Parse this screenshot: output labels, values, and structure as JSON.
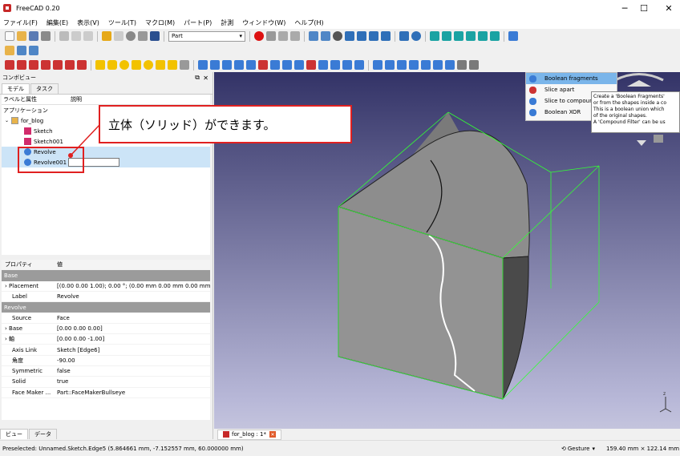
{
  "window": {
    "title": "FreeCAD 0.20"
  },
  "menubar": [
    "ファイル(F)",
    "編集(E)",
    "表示(V)",
    "ツール(T)",
    "マクロ(M)",
    "パート(P)",
    "計測",
    "ウィンドウ(W)",
    "ヘルプ(H)"
  ],
  "toolbar": {
    "workbench": "Part"
  },
  "combo": {
    "title": "コンボビュー",
    "tabs": [
      "モデル",
      "タスク"
    ],
    "tree_headers": [
      "ラベルと属性",
      "説明"
    ],
    "tree": {
      "root": "アプリケーション",
      "doc": "for_blog",
      "items": [
        "Sketch",
        "Sketch001",
        "Revolve",
        "Revolve001"
      ]
    },
    "props_headers": [
      "プロパティ",
      "値"
    ],
    "groups": [
      {
        "name": "Base",
        "rows": [
          {
            "k": "Placement",
            "v": "[(0.00 0.00 1.00); 0.00 °; (0.00 mm  0.00 mm  0.00 mm)]",
            "exp": true
          },
          {
            "k": "Label",
            "v": "Revolve",
            "exp": false
          }
        ]
      },
      {
        "name": "Revolve",
        "rows": [
          {
            "k": "Source",
            "v": "Face",
            "exp": false
          },
          {
            "k": "Base",
            "v": "[0.00 0.00 0.00]",
            "exp": true
          },
          {
            "k": "軸",
            "v": "[0.00 0.00 -1.00]",
            "exp": true
          },
          {
            "k": "Axis Link",
            "v": "Sketch [Edge6]",
            "exp": false
          },
          {
            "k": "角度",
            "v": "-90.00",
            "exp": false
          },
          {
            "k": "Symmetric",
            "v": "false",
            "exp": false
          },
          {
            "k": "Solid",
            "v": "true",
            "exp": false
          },
          {
            "k": "Face Maker ...",
            "v": "Part::FaceMakerBullseye",
            "exp": false
          }
        ]
      }
    ],
    "bottom_tabs": [
      "ビュー",
      "データ"
    ]
  },
  "boolean_menu": [
    "Boolean fragments",
    "Slice apart",
    "Slice to compound",
    "Boolean XOR"
  ],
  "tooltip": [
    "Create a 'Boolean Fragments'",
    "or from the shapes inside a co",
    "This is a boolean union which",
    "of the original shapes.",
    "A 'Compound Filter' can be us"
  ],
  "callout": "立体（ソリッド）ができます。",
  "doc_tab": "for_blog : 1*",
  "status": {
    "preselected": "Preselected: Unnamed.Sketch.Edge5 (5.864661 mm, -7.152557 mm, 60.000000 mm)",
    "nav": "Gesture",
    "dims": "159.40 mm × 122.14 mm"
  },
  "colors": {
    "accent_red": "#e02020",
    "menu_highlight": "#7ab5ea",
    "selection_green": "#33ff33"
  }
}
